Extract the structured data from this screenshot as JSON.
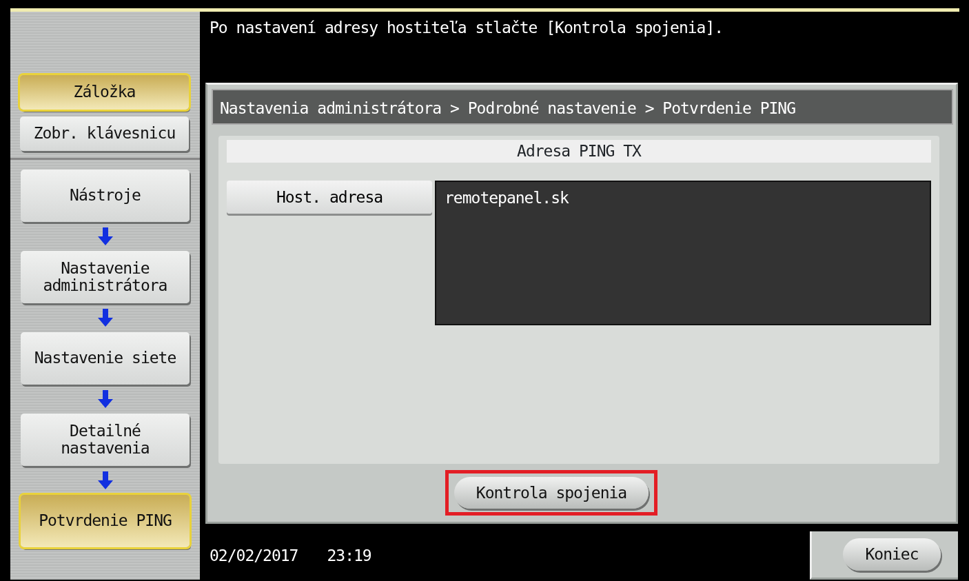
{
  "message": "Po nastavení adresy hostiteľa stlačte [Kontrola spojenia].",
  "shortcuts": [
    {
      "label": "Záložka",
      "selected": true
    },
    {
      "label": "Zobr. klávesnicu",
      "selected": false
    }
  ],
  "path": [
    {
      "label": "Nástroje",
      "selected": false
    },
    {
      "label": "Nastavenie administrátora",
      "selected": false
    },
    {
      "label": "Nastavenie siete",
      "selected": false
    },
    {
      "label": "Detailné nastavenia",
      "selected": false
    },
    {
      "label": "Potvrdenie PING",
      "selected": true
    }
  ],
  "breadcrumb": "Nastavenia administrátora > Podrobné nastavenie > Potvrdenie PING",
  "section_title": "Adresa PING TX",
  "host_button": "Host. adresa",
  "host_value": "remotepanel.sk",
  "check_button": {
    "label": "Kontrola spojenia",
    "highlighted": true
  },
  "date": "02/02/2017",
  "time": "23:19",
  "close_button": "Koniec"
}
